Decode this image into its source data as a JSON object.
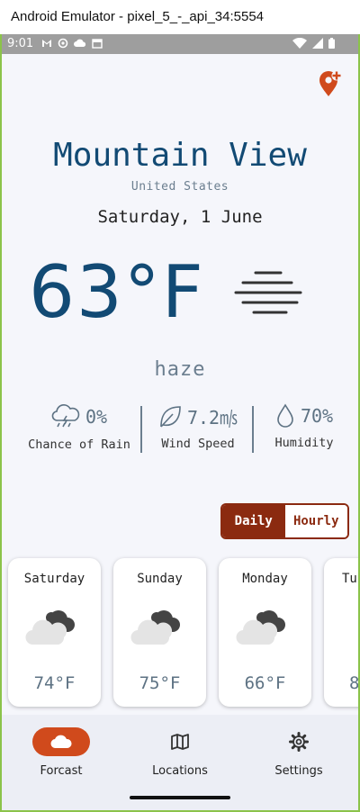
{
  "window": {
    "title": "Android Emulator - pixel_5_-_api_34:5554"
  },
  "status_bar": {
    "time": "9:01",
    "icons": [
      "gmail-icon",
      "sync-icon",
      "cloud-icon",
      "calendar-icon",
      "wifi-icon",
      "signal-icon",
      "battery-icon"
    ]
  },
  "location": {
    "city": "Mountain View",
    "country": "United States"
  },
  "date": "Saturday, 1 June",
  "current": {
    "temperature": "63°F",
    "condition": "haze",
    "condition_icon": "haze-icon"
  },
  "stats": [
    {
      "icon": "rain-cloud-icon",
      "value": "0%",
      "label": "Chance of Rain"
    },
    {
      "icon": "leaf-icon",
      "value": "7.2㎧",
      "label": "Wind Speed"
    },
    {
      "icon": "droplet-icon",
      "value": "70%",
      "label": "Humidity"
    }
  ],
  "toggle": {
    "daily": "Daily",
    "hourly": "Hourly",
    "selected": "Daily"
  },
  "forecast": [
    {
      "day": "Saturday",
      "temp": "74°F",
      "icon": "cloudy-icon"
    },
    {
      "day": "Sunday",
      "temp": "75°F",
      "icon": "cloudy-icon"
    },
    {
      "day": "Monday",
      "temp": "66°F",
      "icon": "cloudy-icon"
    },
    {
      "day": "Tu",
      "temp": "8",
      "icon": "cloudy-icon"
    }
  ],
  "nav": [
    {
      "label": "Forcast",
      "icon": "cloud-icon",
      "active": true
    },
    {
      "label": "Locations",
      "icon": "map-icon",
      "active": false
    },
    {
      "label": "Settings",
      "icon": "gear-icon",
      "active": false
    }
  ],
  "colors": {
    "accent": "#d04a1c",
    "toggle_dark": "#8b2a10",
    "primary_text": "#124a74",
    "muted_text": "#6b7e8f",
    "background": "#f5f6fb",
    "emulator_frame": "#8bc34a"
  }
}
